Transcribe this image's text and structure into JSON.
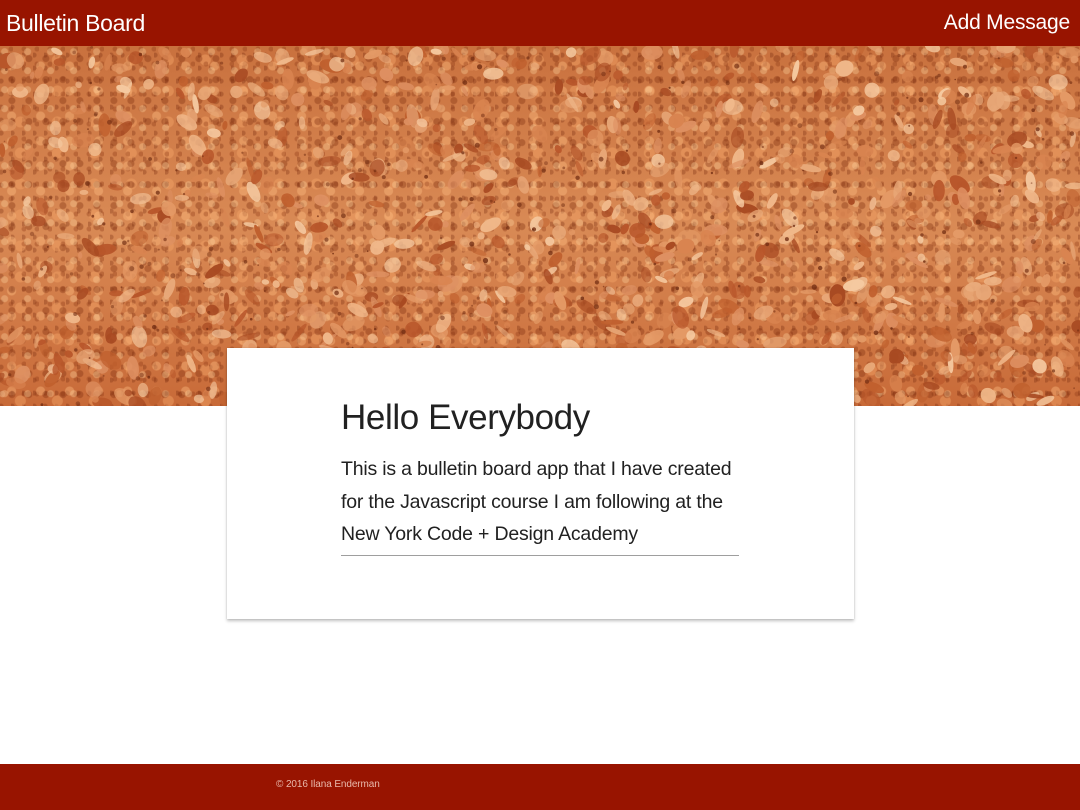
{
  "navbar": {
    "brand": "Bulletin Board",
    "add_message": "Add Message"
  },
  "hero": {
    "image": "cork-board-texture"
  },
  "card": {
    "title": "Hello Everybody",
    "text": "This is a bulletin board app that I have created for the Javascript course I am following at the New York Code + Design Academy"
  },
  "footer": {
    "copyright": "© 2016 Ilana Enderman"
  },
  "colors": {
    "primary": "#981400",
    "card_background": "#ffffff",
    "text": "#212121"
  }
}
